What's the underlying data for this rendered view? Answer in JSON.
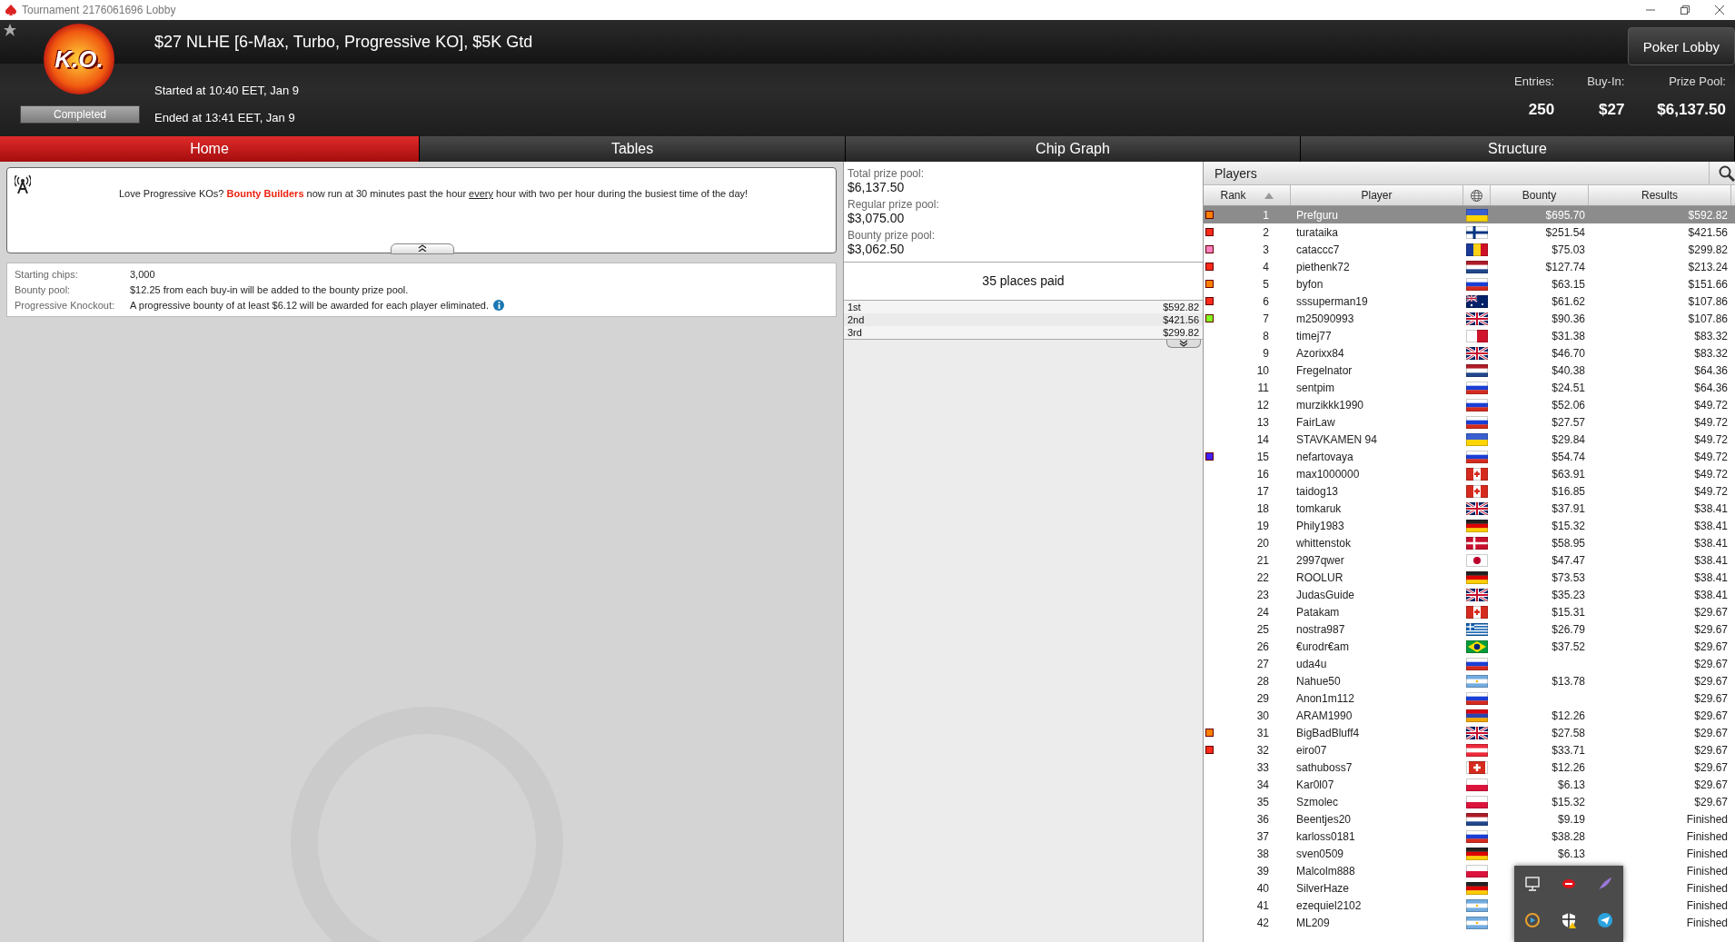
{
  "window": {
    "title": "Tournament 2176061696 Lobby"
  },
  "header": {
    "title": "$27 NLHE [6-Max, Turbo, Progressive KO], $5K Gtd",
    "logo_text": "K.O.",
    "status": "Completed",
    "started": "Started at 10:40 EET, Jan 9",
    "ended": "Ended at 13:41 EET, Jan 9",
    "poker_lobby_button": "Poker Lobby",
    "stats": [
      {
        "label": "Entries:",
        "value": "250"
      },
      {
        "label": "Buy-In:",
        "value": "$27"
      },
      {
        "label": "Prize Pool:",
        "value": "$6,137.50"
      }
    ]
  },
  "tabs": [
    {
      "label": "Home",
      "selected": true
    },
    {
      "label": "Tables",
      "selected": false
    },
    {
      "label": "Chip Graph",
      "selected": false
    },
    {
      "label": "Structure",
      "selected": false
    }
  ],
  "news": {
    "message": "Love Progressive KOs? **Bounty Builders** now run at 30 minutes past the hour *every* hour with two per hour during the busiest time of the day!",
    "expanded": true
  },
  "details": [
    {
      "kind": "plain",
      "label": "Starting chips:",
      "value": "3,000"
    },
    {
      "kind": "plain",
      "label": "Bounty pool:",
      "value": "$12.25 from each buy-in will be added to the bounty prize pool."
    },
    {
      "kind": "info",
      "label": "Progressive Knockout:",
      "value": "A progressive bounty of at least $6.12 will be awarded for each player eliminated."
    }
  ],
  "prize_pools": [
    {
      "label": "Total prize pool:",
      "value": "$6,137.50"
    },
    {
      "label": "Regular prize pool:",
      "value": "$3,075.00"
    },
    {
      "label": "Bounty prize pool:",
      "value": "$3,062.50"
    }
  ],
  "places_paid": "35 places paid",
  "payouts": [
    {
      "place": "1st",
      "amount": "$592.82"
    },
    {
      "place": "2nd",
      "amount": "$421.56"
    },
    {
      "place": "3rd",
      "amount": "$299.82"
    }
  ],
  "players": {
    "title": "Players",
    "columns": [
      "Rank",
      "Player",
      "Bounty",
      "Results"
    ],
    "rows": [
      {
        "rank": "1",
        "player": "Prefguru",
        "kind": "ua",
        "bounty": "$695.70",
        "result": "$592.82",
        "selected": true,
        "color": "#ff8000"
      },
      {
        "rank": "2",
        "player": "turataika",
        "kind": "fi",
        "bounty": "$251.54",
        "result": "$421.56",
        "selected": false,
        "color": "#ff2a1a"
      },
      {
        "rank": "3",
        "player": "cataccc7",
        "kind": "ro",
        "bounty": "$75.03",
        "result": "$299.82",
        "selected": false,
        "color": "#ff80c0"
      },
      {
        "rank": "4",
        "player": "piethenk72",
        "kind": "nl",
        "bounty": "$127.74",
        "result": "$213.24",
        "selected": false,
        "color": "#ff2a1a"
      },
      {
        "rank": "5",
        "player": "byfon",
        "kind": "ru",
        "bounty": "$63.15",
        "result": "$151.66",
        "selected": false,
        "color": "#ff8000"
      },
      {
        "rank": "6",
        "player": "sssuperman19",
        "kind": "au",
        "bounty": "$61.62",
        "result": "$107.86",
        "selected": false,
        "color": "#ff2a1a"
      },
      {
        "rank": "7",
        "player": "m25090993",
        "kind": "gb",
        "bounty": "$90.36",
        "result": "$107.86",
        "selected": false,
        "color": "#80ff20"
      },
      {
        "rank": "8",
        "player": "timej77",
        "kind": "mt",
        "bounty": "$31.38",
        "result": "$83.32",
        "selected": false
      },
      {
        "rank": "9",
        "player": "Azorixx84",
        "kind": "gb",
        "bounty": "$46.70",
        "result": "$83.32",
        "selected": false
      },
      {
        "rank": "10",
        "player": "Fregelnator",
        "kind": "nl",
        "bounty": "$40.38",
        "result": "$64.36",
        "selected": false
      },
      {
        "rank": "11",
        "player": "sentpim",
        "kind": "ru",
        "bounty": "$24.51",
        "result": "$64.36",
        "selected": false
      },
      {
        "rank": "12",
        "player": "murzikkk1990",
        "kind": "ru",
        "bounty": "$52.06",
        "result": "$49.72",
        "selected": false
      },
      {
        "rank": "13",
        "player": "FairLaw",
        "kind": "ru",
        "bounty": "$27.57",
        "result": "$49.72",
        "selected": false
      },
      {
        "rank": "14",
        "player": "STAVKAMEN 94",
        "kind": "ua",
        "bounty": "$29.84",
        "result": "$49.72",
        "selected": false
      },
      {
        "rank": "15",
        "player": "nefartovaya",
        "kind": "ru",
        "bounty": "$54.74",
        "result": "$49.72",
        "selected": false,
        "color": "#4020ff"
      },
      {
        "rank": "16",
        "player": "max1000000",
        "kind": "ca",
        "bounty": "$63.91",
        "result": "$49.72",
        "selected": false
      },
      {
        "rank": "17",
        "player": "taidog13",
        "kind": "ca",
        "bounty": "$16.85",
        "result": "$49.72",
        "selected": false
      },
      {
        "rank": "18",
        "player": "tomkaruk",
        "kind": "gb",
        "bounty": "$37.91",
        "result": "$38.41",
        "selected": false
      },
      {
        "rank": "19",
        "player": "Phily1983",
        "kind": "de",
        "bounty": "$15.32",
        "result": "$38.41",
        "selected": false
      },
      {
        "rank": "20",
        "player": "whittenstok",
        "kind": "dk",
        "bounty": "$58.95",
        "result": "$38.41",
        "selected": false
      },
      {
        "rank": "21",
        "player": "2997qwer",
        "kind": "jp",
        "bounty": "$47.47",
        "result": "$38.41",
        "selected": false
      },
      {
        "rank": "22",
        "player": "ROOLUR",
        "kind": "de",
        "bounty": "$73.53",
        "result": "$38.41",
        "selected": false
      },
      {
        "rank": "23",
        "player": "JudasGuide",
        "kind": "gb",
        "bounty": "$35.23",
        "result": "$38.41",
        "selected": false
      },
      {
        "rank": "24",
        "player": "Patakam",
        "kind": "ca",
        "bounty": "$15.31",
        "result": "$29.67",
        "selected": false
      },
      {
        "rank": "25",
        "player": "nostra987",
        "kind": "gr",
        "bounty": "$26.79",
        "result": "$29.67",
        "selected": false
      },
      {
        "rank": "26",
        "player": "€urodr€am",
        "kind": "br",
        "bounty": "$37.52",
        "result": "$29.67",
        "selected": false
      },
      {
        "rank": "27",
        "player": "uda4u",
        "kind": "ru",
        "result": "$29.67",
        "selected": false
      },
      {
        "rank": "28",
        "player": "Nahue50",
        "kind": "ar",
        "bounty": "$13.78",
        "result": "$29.67",
        "selected": false
      },
      {
        "rank": "29",
        "player": "Anon1m112",
        "kind": "ru",
        "result": "$29.67",
        "selected": false
      },
      {
        "rank": "30",
        "player": "ARAM1990",
        "kind": "am",
        "bounty": "$12.26",
        "result": "$29.67",
        "selected": false
      },
      {
        "rank": "31",
        "player": "BigBadBluff4",
        "kind": "gb",
        "bounty": "$27.58",
        "result": "$29.67",
        "selected": false,
        "color": "#ff8000"
      },
      {
        "rank": "32",
        "player": "eiro07",
        "kind": "at",
        "bounty": "$33.71",
        "result": "$29.67",
        "selected": false,
        "color": "#ff2a1a"
      },
      {
        "rank": "33",
        "player": "sathuboss7",
        "kind": "ch",
        "bounty": "$12.26",
        "result": "$29.67",
        "selected": false
      },
      {
        "rank": "34",
        "player": "Kar0l07",
        "kind": "pl",
        "bounty": "$6.13",
        "result": "$29.67",
        "selected": false
      },
      {
        "rank": "35",
        "player": "Szmolec",
        "kind": "pl",
        "bounty": "$15.32",
        "result": "$29.67",
        "selected": false
      },
      {
        "rank": "36",
        "player": "Beentjes20",
        "kind": "nl",
        "bounty": "$9.19",
        "result": "Finished",
        "selected": false
      },
      {
        "rank": "37",
        "player": "karloss0181",
        "kind": "ru",
        "bounty": "$38.28",
        "result": "Finished",
        "selected": false
      },
      {
        "rank": "38",
        "player": "sven0509",
        "kind": "de",
        "bounty": "$6.13",
        "result": "Finished",
        "selected": false
      },
      {
        "rank": "39",
        "player": "Malcolm888",
        "kind": "pl",
        "result": "Finished",
        "selected": false
      },
      {
        "rank": "40",
        "player": "SilverHaze",
        "kind": "de",
        "result": "Finished",
        "selected": false
      },
      {
        "rank": "41",
        "player": "ezequiel2102",
        "kind": "ar",
        "result": "Finished",
        "selected": false
      },
      {
        "rank": "42",
        "player": "ML209",
        "kind": "ar",
        "result": "Finished",
        "selected": false
      }
    ]
  }
}
